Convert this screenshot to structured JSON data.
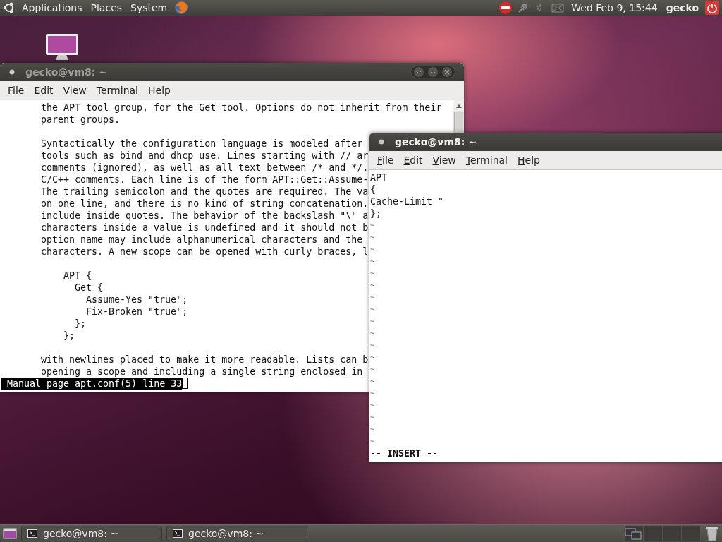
{
  "top_panel": {
    "menus": [
      "Applications",
      "Places",
      "System"
    ],
    "clock": "Wed Feb 9, 15:44",
    "user": "gecko"
  },
  "windows": [
    {
      "kind": "pager",
      "focused": false,
      "title": "gecko@vm8: ~",
      "menu": [
        "File",
        "Edit",
        "View",
        "Terminal",
        "Help"
      ],
      "paragraphs": [
        [
          "the APT tool group, for the Get tool. Options do not inherit from their",
          "parent groups."
        ],
        [
          "Syntactically the configuration language is modeled after",
          "tools such as bind and dhcp use. Lines starting with // ar",
          "comments (ignored), as well as all text between /* and */,",
          "C/C++ comments. Each line is of the form APT::Get::Assume-",
          "The trailing semicolon and the quotes are required. The va",
          "on one line, and there is no kind of string concatenation.",
          "include inside quotes. The behavior of the backslash \"\\\" a",
          "characters inside a value is undefined and it should not b",
          "option name may include alphanumerical characters and the",
          "characters. A new scope can be opened with curly braces, l"
        ],
        [
          "    APT {",
          "      Get {",
          "        Assume-Yes \"true\";",
          "        Fix-Broken \"true\";",
          "      };",
          "    };"
        ],
        [
          "with newlines placed to make it more readable. Lists can b",
          "opening a scope and including a single string enclosed in"
        ]
      ],
      "status_line": "Manual page apt.conf(5) line 33"
    },
    {
      "kind": "editor",
      "focused": true,
      "title": "gecko@vm8: ~",
      "menu": [
        "File",
        "Edit",
        "View",
        "Terminal",
        "Help"
      ],
      "lines": [
        {
          "kind": "text",
          "text": "APT"
        },
        {
          "kind": "text",
          "text": "{"
        },
        {
          "kind": "text",
          "text": "Cache-Limit \""
        },
        {
          "kind": "text",
          "text": "};"
        },
        {
          "kind": "tilde",
          "text": "~"
        },
        {
          "kind": "tilde",
          "text": "~"
        },
        {
          "kind": "tilde",
          "text": "~"
        },
        {
          "kind": "tilde",
          "text": "~"
        },
        {
          "kind": "tilde",
          "text": "~"
        },
        {
          "kind": "tilde",
          "text": "~"
        },
        {
          "kind": "tilde",
          "text": "~"
        },
        {
          "kind": "tilde",
          "text": "~"
        },
        {
          "kind": "tilde",
          "text": "~"
        },
        {
          "kind": "tilde",
          "text": "~"
        },
        {
          "kind": "tilde",
          "text": "~"
        },
        {
          "kind": "tilde",
          "text": "~"
        },
        {
          "kind": "tilde",
          "text": "~"
        },
        {
          "kind": "tilde",
          "text": "~"
        },
        {
          "kind": "tilde",
          "text": "~"
        },
        {
          "kind": "tilde",
          "text": "~"
        },
        {
          "kind": "tilde",
          "text": "~"
        },
        {
          "kind": "tilde",
          "text": "~"
        },
        {
          "kind": "tilde",
          "text": "~"
        }
      ],
      "mode_line": "-- INSERT --"
    }
  ],
  "taskbar": {
    "tasks": [
      "gecko@vm8: ~",
      "gecko@vm8: ~"
    ]
  }
}
